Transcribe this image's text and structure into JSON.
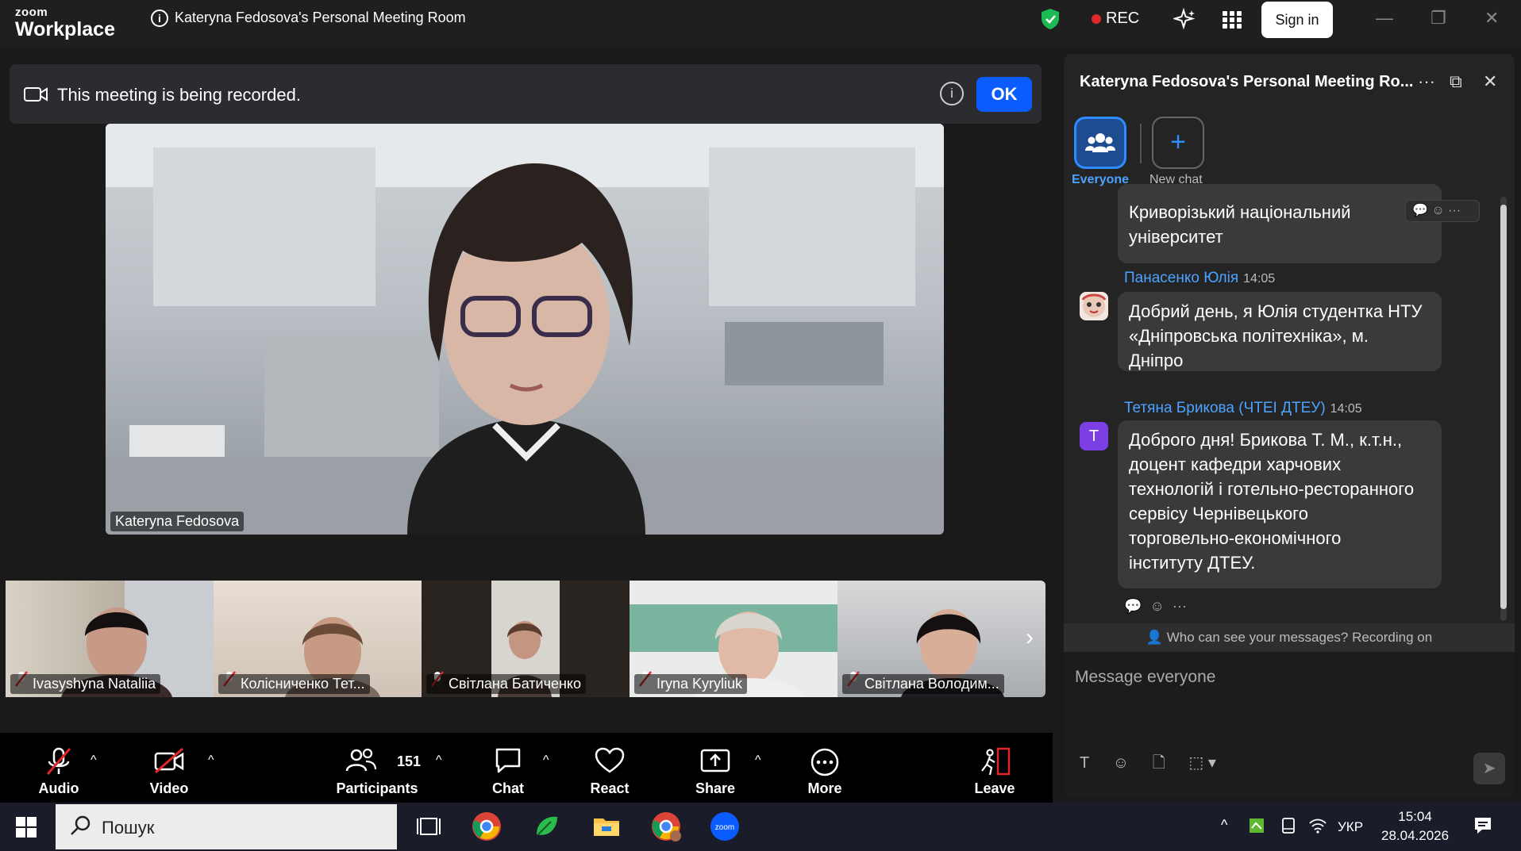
{
  "titlebar": {
    "brand_top": "zoom",
    "brand_bottom": "Workplace",
    "meeting_title": "Kateryna Fedosova's Personal Meeting Room",
    "rec_label": "REC",
    "signin_label": "Sign in"
  },
  "banner": {
    "message": "This meeting is being recorded.",
    "ok_label": "OK"
  },
  "main_video": {
    "speaker_name": "Kateryna Fedosova"
  },
  "thumbnails": [
    {
      "name": "Ivasyshyna Nataliia"
    },
    {
      "name": "Колісниченко Тет..."
    },
    {
      "name": "Світлана Батиченко"
    },
    {
      "name": "Iryna Kyryliuk"
    },
    {
      "name": "Світлана Володим..."
    }
  ],
  "toolbar": {
    "audio": "Audio",
    "video": "Video",
    "participants": "Participants",
    "participants_count": "151",
    "chat": "Chat",
    "react": "React",
    "share": "Share",
    "more": "More",
    "leave": "Leave"
  },
  "chat": {
    "title": "Kateryna Fedosova's Personal Meeting Ro...",
    "tab_everyone": "Everyone",
    "tab_new": "New chat",
    "messages": [
      {
        "text_lines": [
          "Криворізький національний",
          "університет"
        ]
      },
      {
        "sender": "Панасенко Юлія",
        "time": "14:05",
        "text_lines": [
          "Добрий день, я Юлія студентка НТУ",
          "«Дніпровська політехніка», м.",
          "Дніпро"
        ]
      },
      {
        "sender": "Тетяна Брикова (ЧТЕІ ДТЕУ)",
        "time": "14:05",
        "avatar_letter": "T",
        "text_lines": [
          "Доброго дня! Брикова Т. М., к.т.н.,",
          "доцент кафедри харчових",
          "технологій і готельно-ресторанного",
          "сервісу Чернівецького",
          "торговельно-економічного",
          "інституту ДТЕУ."
        ]
      }
    ],
    "notice": "Who can see your messages? Recording on",
    "compose_placeholder": "Message everyone"
  },
  "taskbar": {
    "search_text": "Пошук",
    "lang": "УКР",
    "time": "15:04",
    "date": "28.04.2026"
  },
  "colors": {
    "accent": "#0b5cff",
    "chat_link": "#4ba3ff",
    "rec_dot": "#e02828",
    "shield": "#1db954"
  }
}
